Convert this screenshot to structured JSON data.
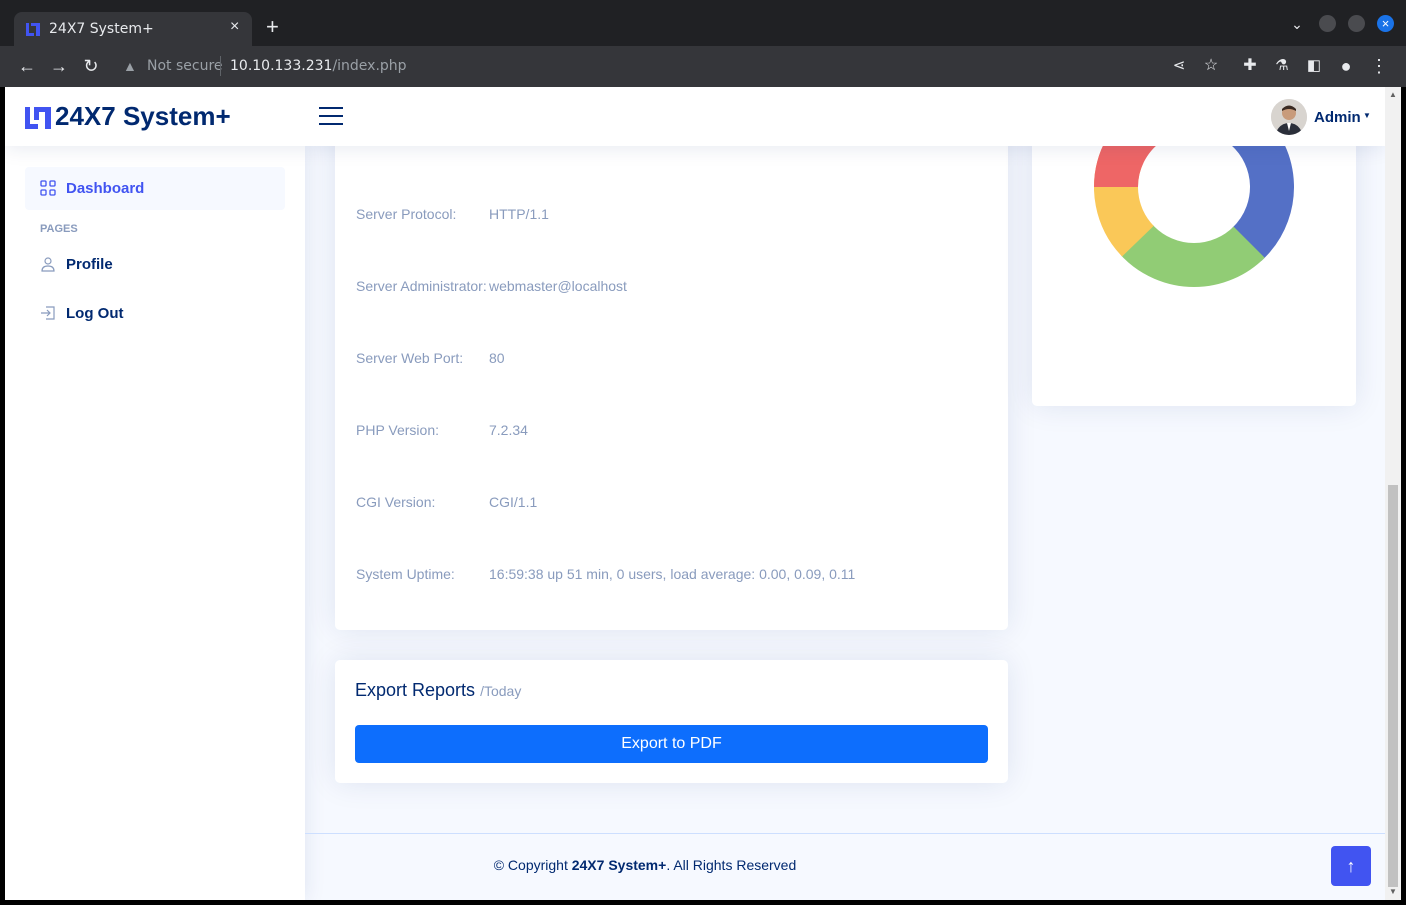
{
  "browser": {
    "tab_title": "24X7 System+",
    "tab_close": "×",
    "new_tab": "+",
    "security_label": "Not secure",
    "url_host": "10.10.133.231",
    "url_path": "/index.php"
  },
  "header": {
    "brand": "24X7 System+",
    "user_name": "Admin"
  },
  "sidebar": {
    "dashboard_label": "Dashboard",
    "pages_heading": "PAGES",
    "profile_label": "Profile",
    "logout_label": "Log Out"
  },
  "server_info": {
    "rows": [
      {
        "label": "Server Protocol:",
        "value": "HTTP/1.1"
      },
      {
        "label": "Server Administrator:",
        "value": "webmaster@localhost"
      },
      {
        "label": "Server Web Port:",
        "value": "80"
      },
      {
        "label": "PHP Version:",
        "value": "7.2.34"
      },
      {
        "label": "CGI Version:",
        "value": "CGI/1.1"
      },
      {
        "label": "System Uptime:",
        "value": "16:59:38 up 51 min, 0 users, load average: 0.00, 0.09, 0.11"
      }
    ]
  },
  "export": {
    "title": "Export Reports",
    "subtitle": "/Today",
    "button_label": "Export to PDF"
  },
  "footer": {
    "prefix": "© Copyright ",
    "brand": "24X7 System+",
    "suffix": ". All Rights Reserved"
  },
  "colors": {
    "brand": "#012970",
    "accent": "#4154f1",
    "button": "#0d6efd",
    "donut_blue": "#5470c6",
    "donut_green": "#91cc75",
    "donut_yellow": "#fac858",
    "donut_red": "#ee6666",
    "donut_cyan": "#73c0de"
  }
}
